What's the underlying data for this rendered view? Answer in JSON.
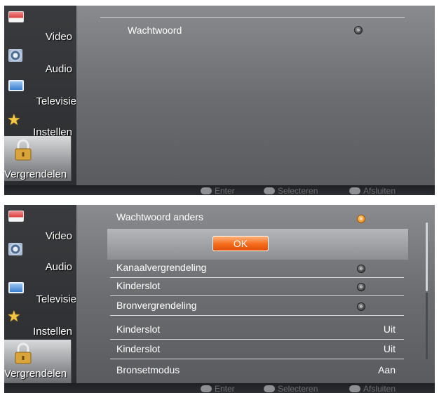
{
  "sidebar": {
    "items": [
      {
        "label": "Video",
        "icon": "video-icon"
      },
      {
        "label": "Audio",
        "icon": "audio-icon"
      },
      {
        "label": "Televisie",
        "icon": "tv-icon"
      },
      {
        "label": "Instellen",
        "icon": "star-icon"
      },
      {
        "label": "Vergrendelen",
        "icon": "lock-icon"
      }
    ]
  },
  "hints": {
    "enter": "Enter",
    "select": "Selecteren",
    "exit": "Afsluiten"
  },
  "screen1": {
    "rows": [
      {
        "label": "Wachtwoord",
        "icon": "arrow-icon"
      }
    ]
  },
  "screen2": {
    "ok_label": "OK",
    "rows": [
      {
        "label": "Wachtwoord anders",
        "icon": "arrow-icon-orange"
      },
      {
        "label": "Kanaalvergrendeling",
        "icon": "arrow-icon"
      },
      {
        "label": "Kinderslot",
        "icon": "arrow-icon"
      },
      {
        "label": "Bronvergrendeling",
        "icon": "arrow-icon"
      },
      {
        "label": "Kinderslot",
        "value": "Uit"
      },
      {
        "label": "Kinderslot",
        "value": "Uit"
      },
      {
        "label": "Bronsetmodus",
        "value": "Aan"
      }
    ]
  },
  "colors": {
    "accent": "#f56a1a",
    "background": "#6f7073",
    "sidebar": "#2c2d30"
  }
}
